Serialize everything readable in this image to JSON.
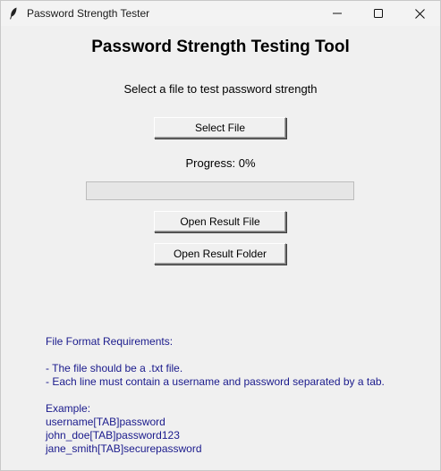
{
  "window": {
    "title": "Password Strength Tester"
  },
  "main": {
    "heading": "Password Strength Testing Tool",
    "subtitle": "Select a file to test password strength",
    "select_file_label": "Select File",
    "progress_label": "Progress: 0%",
    "progress_value": 0,
    "open_result_file_label": "Open Result File",
    "open_result_folder_label": "Open Result Folder"
  },
  "info": {
    "lines": [
      "File Format Requirements:",
      "",
      "- The file should be a .txt file.",
      "- Each line must contain a username and password separated by a tab.",
      "",
      "Example:",
      "username[TAB]password",
      "john_doe[TAB]password123",
      "jane_smith[TAB]securepassword"
    ]
  },
  "icons": {
    "app": "feather-icon",
    "minimize": "minimize-icon",
    "maximize": "maximize-icon",
    "close": "close-icon"
  },
  "colors": {
    "background": "#f0f0f0",
    "info_text": "#1a1a8c"
  }
}
